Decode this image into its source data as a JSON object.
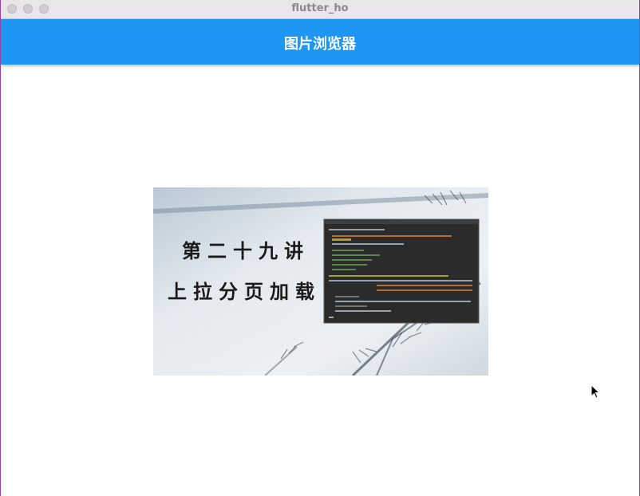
{
  "window": {
    "title": "flutter_ho"
  },
  "appbar": {
    "title": "图片浏览器"
  },
  "image": {
    "heading_line1": "第二十九讲",
    "heading_line2": "上拉分页加载"
  },
  "colors": {
    "appbar": "#1e96f3",
    "titlebar": "#e8e6e8",
    "page": "#ffffff"
  },
  "icons": {
    "cursor": "arrow-cursor-icon"
  }
}
